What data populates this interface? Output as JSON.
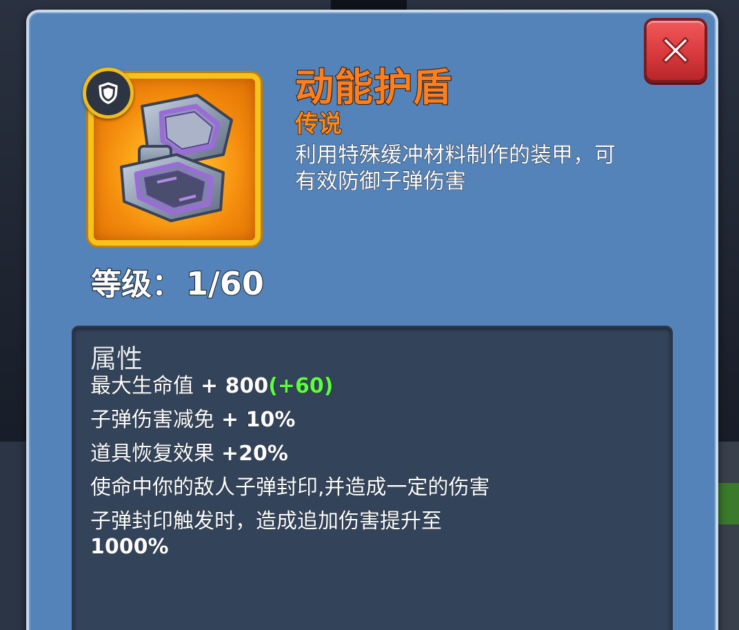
{
  "item": {
    "name": "动能护盾",
    "rarity": "传说",
    "description": "利用特殊缓冲材料制作的装甲，可有效防御子弹伤害",
    "icon": "kinetic-shield-armor-icon",
    "type_badge_icon": "shield-icon",
    "frame_color": "#f6c21c"
  },
  "level": {
    "label": "等级：",
    "value": "1/60",
    "current": 1,
    "max": 60
  },
  "attributes": {
    "title": "属性",
    "lines": [
      {
        "name": "最大生命值",
        "value": "+ 800",
        "bonus": "(+60)"
      },
      {
        "name": "子弹伤害减免",
        "value": "+ 10%"
      },
      {
        "name": "道具恢复效果",
        "value": "+20%"
      },
      {
        "text": "使命中你的敌人子弹封印,并造成一定的伤害"
      },
      {
        "text": "子弹封印触发时，造成追加伤害提升至",
        "strong": "1000%"
      }
    ]
  },
  "close_button": {
    "icon": "close-icon",
    "color": "#d93a3d"
  },
  "colors": {
    "panel": "#5383b8",
    "title_orange": "#ff7f1e",
    "bonus_green": "#5dff3c"
  }
}
